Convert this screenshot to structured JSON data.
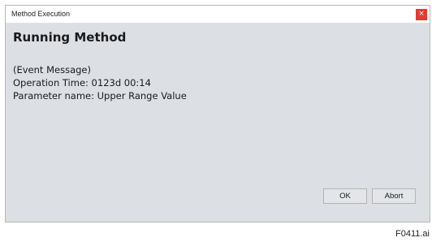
{
  "window": {
    "title": "Method Execution",
    "close_label": "×"
  },
  "content": {
    "heading": "Running Method",
    "lines": [
      "(Event Message)",
      "Operation Time: 0123d 00:14",
      "Parameter name: Upper Range Value"
    ]
  },
  "buttons": {
    "ok_label": "OK",
    "abort_label": "Abort"
  },
  "figure_label": "F0411.ai",
  "colors": {
    "dialog_background": "#dcdfe4",
    "close_button": "#e03c31"
  }
}
